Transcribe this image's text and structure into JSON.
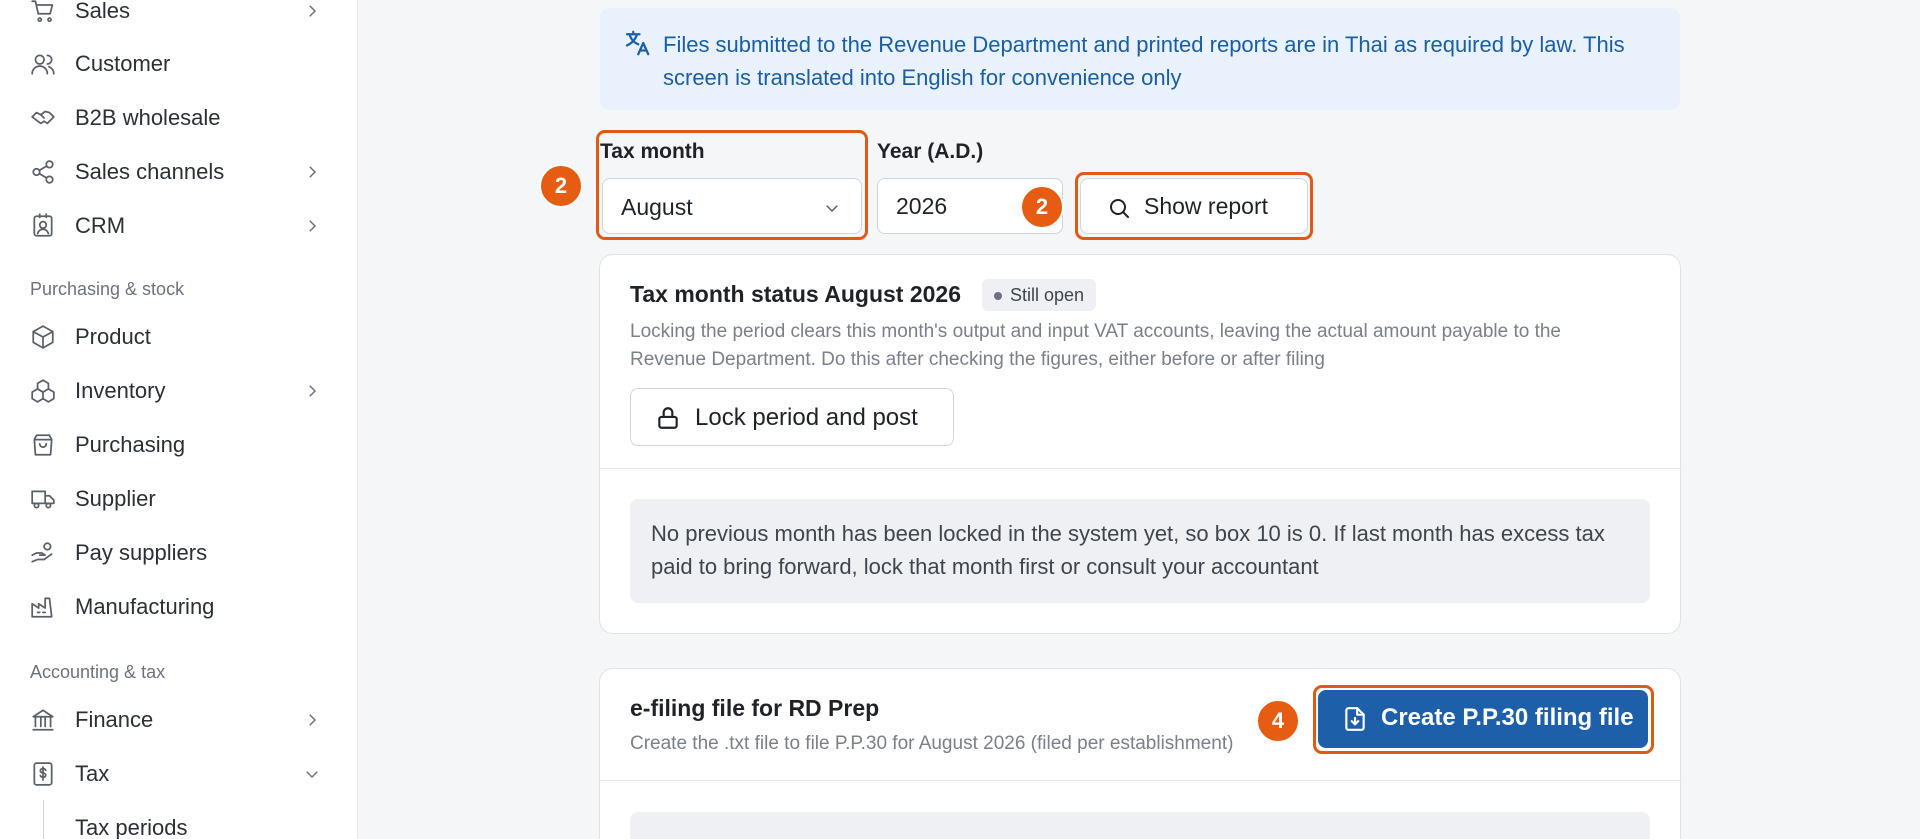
{
  "sidebar": {
    "items_top": [
      {
        "label": "Sales",
        "icon": "cart-icon",
        "has_chevron": true
      },
      {
        "label": "Customer",
        "icon": "users-icon",
        "has_chevron": false
      },
      {
        "label": "B2B wholesale",
        "icon": "handshake-icon",
        "has_chevron": false
      },
      {
        "label": "Sales channels",
        "icon": "share-icon",
        "has_chevron": true
      },
      {
        "label": "CRM",
        "icon": "contact-icon",
        "has_chevron": true
      }
    ],
    "section_purchasing": "Purchasing & stock",
    "items_purchasing": [
      {
        "label": "Product",
        "icon": "box-icon",
        "has_chevron": false
      },
      {
        "label": "Inventory",
        "icon": "boxes-icon",
        "has_chevron": true
      },
      {
        "label": "Purchasing",
        "icon": "bag-icon",
        "has_chevron": false
      },
      {
        "label": "Supplier",
        "icon": "truck-icon",
        "has_chevron": false
      },
      {
        "label": "Pay suppliers",
        "icon": "hand-coins-icon",
        "has_chevron": false
      },
      {
        "label": "Manufacturing",
        "icon": "factory-icon",
        "has_chevron": false
      }
    ],
    "section_accounting": "Accounting & tax",
    "items_accounting": [
      {
        "label": "Finance",
        "icon": "bank-icon",
        "has_chevron": true
      },
      {
        "label": "Tax",
        "icon": "receipt-icon",
        "has_chevron": true,
        "expanded": true
      }
    ],
    "sub_item": "Tax periods"
  },
  "notice": {
    "text": "Files submitted to the Revenue Department and printed reports are in Thai as required by law. This screen is translated into English for convenience only",
    "icon": "translate-icon"
  },
  "filters": {
    "tax_month_label": "Tax month",
    "tax_month_value": "August",
    "year_label": "Year (A.D.)",
    "year_value": "2026",
    "show_report": "Show report"
  },
  "badges": {
    "month": "2",
    "year": "2",
    "create": "4"
  },
  "status_card": {
    "title": "Tax month status August 2026",
    "status": "Still open",
    "description": "Locking the period clears this month's output and input VAT accounts, leaving the actual amount payable to the Revenue Department. Do this after checking the figures, either before or after filing",
    "lock_button": "Lock period and post",
    "info": "No previous month has been locked in the system yet, so box 10 is 0. If last month has excess tax paid to bring forward, lock that month first or consult your accountant"
  },
  "efiling_card": {
    "title": "e-filing file for RD Prep",
    "subtitle": "Create the .txt file to file P.P.30 for August 2026 (filed per establishment)",
    "create_button": "Create P.P.30 filing file"
  },
  "colors": {
    "accent": "#1d5fa8",
    "highlight": "#e05a14",
    "notice_bg": "#e8f1fc"
  }
}
